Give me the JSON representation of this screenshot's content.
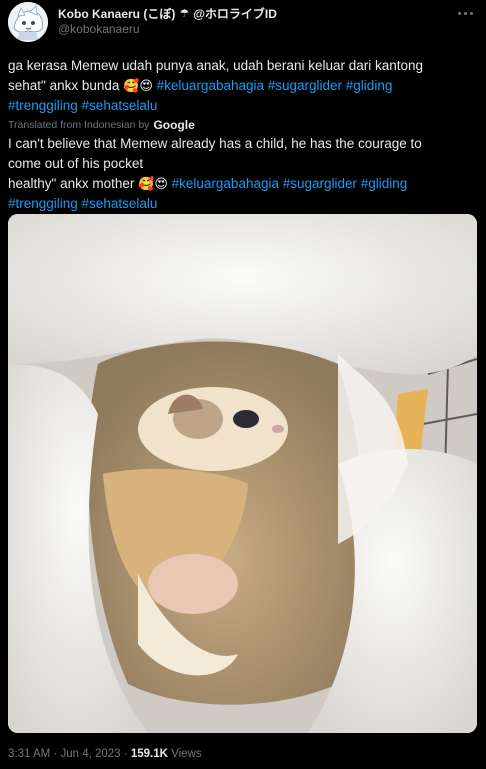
{
  "header": {
    "display_name": "Kobo Kanaeru (こぼ)",
    "name_suffix": "@ホロライブID",
    "handle": "@kobokanaeru"
  },
  "tweet": {
    "original_line1": "ga kerasa Memew udah punya anak, udah berani keluar dari kantong",
    "original_line2_text": "sehat\" ankx bunda",
    "original_tags": "#keluargabahagia #sugarglider #gliding",
    "original_line3_tags": "#trenggiling #sehatselalu",
    "translated_label": "Translated from Indonesian by",
    "translated_provider": "Google",
    "translation_line1": "I can't believe that Memew already has a child, he has the courage to",
    "translation_line2": "come out of his pocket",
    "translation_line3_text": "healthy\" ankx mother",
    "translation_tags": "#keluargabahagia #sugarglider #gliding",
    "translation_line4_tags": "#trenggiling #sehatselalu"
  },
  "icons": {
    "umbrella": "umbrella-icon",
    "more": "more-options-icon",
    "emoji1": "smiling-face-with-hearts",
    "emoji2": "heart-eyes"
  },
  "footer": {
    "time": "3:31 AM",
    "separator": "·",
    "date": "Jun 4, 2023",
    "views_count": "159.1K",
    "views_label": "Views"
  },
  "colors": {
    "background": "#000000",
    "text": "#e7e9ea",
    "secondary": "#71767b",
    "link": "#1d9bf0"
  }
}
